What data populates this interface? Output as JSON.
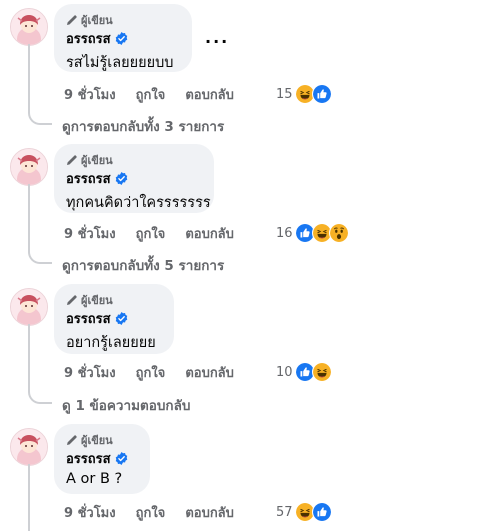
{
  "comments": [
    {
      "author_tag": "ผู้เขียน",
      "name": "อรรถรส",
      "text": "รสไม่รู้เลยยยยบบ",
      "more": "...",
      "time": "9 ชั่วโมง",
      "like": "ถูกใจ",
      "reply": "ตอบกลับ",
      "reaction_count": "15",
      "reactions": [
        "haha-icon",
        "like-icon"
      ],
      "replies_link": "ดูการตอบกลับทั้ง 3 รายการ"
    },
    {
      "author_tag": "ผู้เขียน",
      "name": "อรรถรส",
      "text": "ทุกคนคิดว่าใครรรรรรร",
      "time": "9 ชั่วโมง",
      "like": "ถูกใจ",
      "reply": "ตอบกลับ",
      "reaction_count": "16",
      "reactions": [
        "like-icon",
        "haha-icon",
        "wow-icon"
      ],
      "replies_link": "ดูการตอบกลับทั้ง 5 รายการ"
    },
    {
      "author_tag": "ผู้เขียน",
      "name": "อรรถรส",
      "text": "อยากรู้เลยยยย",
      "time": "9 ชั่วโมง",
      "like": "ถูกใจ",
      "reply": "ตอบกลับ",
      "reaction_count": "10",
      "reactions": [
        "like-icon",
        "haha-icon"
      ],
      "replies_link": "ดู 1 ข้อความตอบกลับ"
    },
    {
      "author_tag": "ผู้เขียน",
      "name": "อรรถรส",
      "text": "A or B ?",
      "time": "9 ชั่วโมง",
      "like": "ถูกใจ",
      "reply": "ตอบกลับ",
      "reaction_count": "57",
      "reactions": [
        "haha-icon",
        "like-icon"
      ]
    }
  ],
  "colors": {
    "bubble": "#f0f2f5",
    "meta_text": "#65676b",
    "verified": "#1877f2",
    "like": "#1877f2",
    "haha": "#f7b125"
  }
}
